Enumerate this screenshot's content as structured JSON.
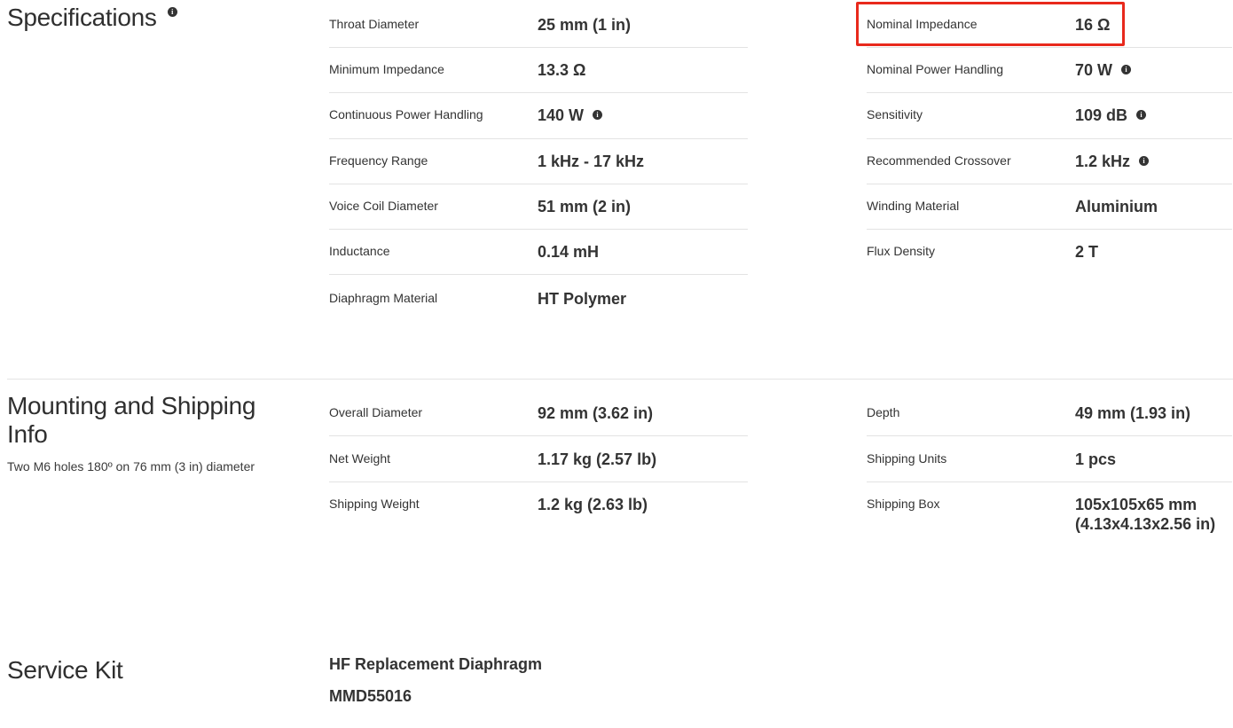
{
  "specifications": {
    "title": "Specifications",
    "left": [
      {
        "label": "Throat Diameter",
        "value": "25 mm (1 in)",
        "info": false
      },
      {
        "label": "Minimum Impedance",
        "value": "13.3 Ω",
        "info": false
      },
      {
        "label": "Continuous Power Handling",
        "value": "140 W",
        "info": true
      },
      {
        "label": "Frequency Range",
        "value": "1 kHz - 17 kHz",
        "info": false
      },
      {
        "label": "Voice Coil Diameter",
        "value": "51 mm (2 in)",
        "info": false
      },
      {
        "label": "Inductance",
        "value": "0.14 mH",
        "info": false
      },
      {
        "label": "Diaphragm Material",
        "value": "HT Polymer",
        "info": false
      }
    ],
    "right": [
      {
        "label": "Nominal Impedance",
        "value": "16 Ω",
        "info": false
      },
      {
        "label": "Nominal Power Handling",
        "value": "70 W",
        "info": true
      },
      {
        "label": "Sensitivity",
        "value": "109 dB",
        "info": true
      },
      {
        "label": "Recommended Crossover",
        "value": "1.2 kHz",
        "info": true
      },
      {
        "label": "Winding Material",
        "value": "Aluminium",
        "info": false
      },
      {
        "label": "Flux Density",
        "value": "2 T",
        "info": false
      }
    ]
  },
  "mounting": {
    "title_line1": "Mounting and Shipping",
    "title_line2": "Info",
    "subtitle": "Two M6 holes 180º on 76 mm (3 in) diameter",
    "left": [
      {
        "label": "Overall Diameter",
        "value": "92 mm (3.62 in)"
      },
      {
        "label": "Net Weight",
        "value": "1.17 kg (2.57 lb)"
      },
      {
        "label": "Shipping Weight",
        "value": "1.2 kg (2.63 lb)"
      }
    ],
    "right": [
      {
        "label": "Depth",
        "value": "49 mm (1.93 in)"
      },
      {
        "label": "Shipping Units",
        "value": "1 pcs"
      },
      {
        "label": "Shipping Box",
        "value_line1": "105x105x65 mm",
        "value_line2": "(4.13x4.13x2.56 in)"
      }
    ]
  },
  "service_kit": {
    "title": "Service Kit",
    "name": "HF Replacement Diaphragm",
    "code": "MMD55016"
  },
  "colors": {
    "highlight": "#e8291c",
    "text": "#333333",
    "divider": "#e3e3e3"
  },
  "icons": {
    "info": "info-icon",
    "info_glyph": "i"
  }
}
